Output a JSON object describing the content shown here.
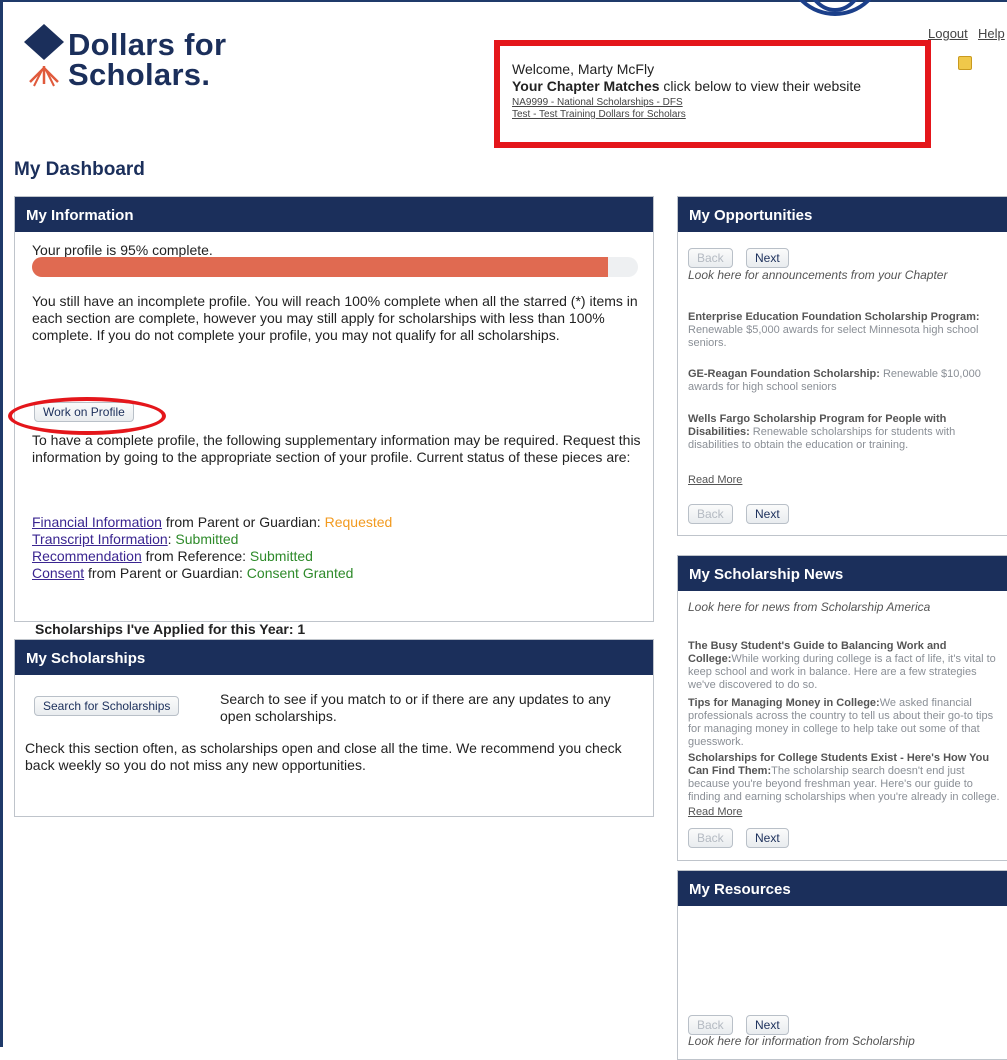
{
  "brand": {
    "line1": "Dollars for",
    "line2": "Scholars."
  },
  "header": {
    "logout": "Logout",
    "help": "Help",
    "welcome": "Welcome, Marty McFly",
    "matches_bold": "Your Chapter Matches",
    "matches_rest": " click below to view their website",
    "chapters": [
      "NA9999 - National Scholarships - DFS",
      "Test - Test Training Dollars for Scholars"
    ]
  },
  "page_title": "My Dashboard",
  "my_information": {
    "title": "My Information",
    "profile_status": "Your profile is 95% complete.",
    "progress_percent": 95,
    "incomplete_text": "You still have an incomplete profile. You will reach 100% complete when all the starred (*) items in each section are complete, however you may still apply for scholarships with less than 100% complete. If you do not complete your profile, you may not qualify for all scholarships.",
    "work_on_profile": "Work on Profile",
    "supplementary_text": "To have a complete profile, the following supplementary information may be required. Request this information by going to the appropriate section of your profile. Current status of these pieces are:",
    "items": [
      {
        "link": "Financial Information",
        "from": " from Parent or Guardian: ",
        "status": "Requested",
        "kind": "req"
      },
      {
        "link": "Transcript Information",
        "from": ": ",
        "status": "Submitted",
        "kind": "sub"
      },
      {
        "link": "Recommendation",
        "from": " from Reference: ",
        "status": "Submitted",
        "kind": "sub"
      },
      {
        "link": "Consent",
        "from": " from Parent or Guardian: ",
        "status": "Consent Granted",
        "kind": "sub"
      }
    ],
    "applied": "Scholarships I've Applied for this Year: 1"
  },
  "my_scholarships": {
    "title": "My Scholarships",
    "search_button": "Search for Scholarships",
    "search_text": "Search to see if you match to or if there are any updates to any open scholarships.",
    "check_text": "Check this section often, as scholarships open and close all the time. We recommend you check back weekly so you do not miss any new opportunities."
  },
  "nav_buttons": {
    "back": "Back",
    "next": "Next"
  },
  "my_opportunities": {
    "title": "My Opportunities",
    "intro": "Look here for announcements from your Chapter",
    "items": [
      {
        "title": "Enterprise Education Foundation Scholarship Program:",
        "text": " Renewable $5,000 awards for select Minnesota high school seniors."
      },
      {
        "title": "GE-Reagan Foundation Scholarship:",
        "text": " Renewable $10,000 awards for high school seniors"
      },
      {
        "title": "Wells Fargo Scholarship Program for People with Disabilities:",
        "text": " Renewable scholarships for students with disabilities to obtain the education or training."
      }
    ],
    "read_more": "Read More"
  },
  "my_news": {
    "title": "My Scholarship News",
    "intro": "Look here for news from Scholarship America",
    "items": [
      {
        "title": "The Busy Student's Guide to Balancing Work and College:",
        "text": "While working during college is a fact of life, it's vital to keep school and work in balance. Here are a few strategies we've discovered to do so."
      },
      {
        "title": "Tips for Managing Money in College:",
        "text": "We asked financial professionals across the country to tell us about their go-to tips for managing money in college to help take out some of that guesswork."
      },
      {
        "title": "Scholarships for College Students Exist - Here's How You Can Find Them:",
        "text": "The scholarship search doesn't end just because you're beyond freshman year. Here's our guide to finding and earning scholarships when you're already in college."
      }
    ],
    "read_more": "Read More"
  },
  "my_resources": {
    "title": "My Resources",
    "intro": "Look here for information from Scholarship"
  }
}
